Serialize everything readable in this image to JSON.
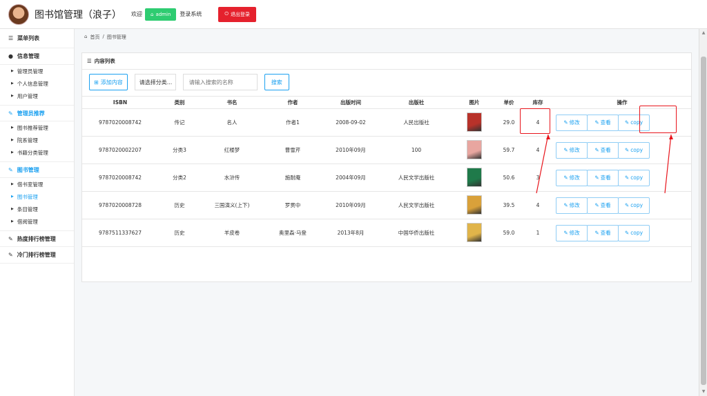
{
  "header": {
    "title": "图书馆管理（浪子）",
    "welcome": "欢迎",
    "admin_label": "admin",
    "login_text": "登录系统",
    "logout_label": "退出登录"
  },
  "sidebar": {
    "menu_title": "菜单列表",
    "groups": [
      {
        "label": "信息管理",
        "items": [
          "管理员管理",
          "个人信息管理",
          "用户管理"
        ]
      },
      {
        "label": "管理员推荐",
        "items": [
          "图书推荐管理",
          "院系管理",
          "书籍分类管理"
        ]
      },
      {
        "label": "图书管理",
        "items": [
          "借书室管理",
          "图书管理",
          "条目管理",
          "借阅管理"
        ]
      },
      {
        "label": "热度排行榜管理",
        "items": []
      },
      {
        "label": "冷门排行榜管理",
        "items": []
      }
    ]
  },
  "breadcrumb": {
    "home": "首页",
    "sep": "/",
    "current": "图书管理"
  },
  "panel": {
    "title": "内容列表",
    "add_label": "添加内容",
    "select_label": "请选择分类...",
    "search_placeholder": "请输入搜索的名称",
    "search_label": "搜索"
  },
  "table": {
    "columns": [
      "ISBN",
      "类别",
      "书名",
      "作者",
      "出版时间",
      "出版社",
      "图片",
      "单价",
      "库存",
      "操作"
    ],
    "rows": [
      {
        "isbn": "9787020008742",
        "category": "传记",
        "name": "名人",
        "author": "作者1",
        "date": "2008-09-02",
        "publisher": "人民出版社",
        "price": "29.0",
        "stock": "4",
        "img_color": "#b8322a"
      },
      {
        "isbn": "9787020002207",
        "category": "分类3",
        "name": "红楼梦",
        "author": "曹雪芹",
        "date": "2010年09月",
        "publisher": "100",
        "price": "59.7",
        "stock": "4",
        "img_color": "#e8a6a0"
      },
      {
        "isbn": "9787020008742",
        "category": "分类2",
        "name": "水浒传",
        "author": "施耐庵",
        "date": "2004年09月",
        "publisher": "人民文学出版社",
        "price": "50.6",
        "stock": "3",
        "img_color": "#1f7a4a"
      },
      {
        "isbn": "9787020008728",
        "category": "历史",
        "name": "三国演义(上下)",
        "author": "罗贯中",
        "date": "2010年09月",
        "publisher": "人民文学出版社",
        "price": "39.5",
        "stock": "4",
        "img_color": "#d9a13a"
      },
      {
        "isbn": "9787511337627",
        "category": "历史",
        "name": "羊皮卷",
        "author": "奥里森·马登",
        "date": "2013年8月",
        "publisher": "中国华侨出版社",
        "price": "59.0",
        "stock": "1",
        "img_color": "#e0b44a"
      }
    ],
    "ops": {
      "edit": "修改",
      "view": "查看",
      "copy": "copy"
    }
  },
  "colors": {
    "accent": "#1aa0f0",
    "success": "#2ecc71",
    "danger": "#e5212d",
    "annotation": "#e8131a"
  }
}
